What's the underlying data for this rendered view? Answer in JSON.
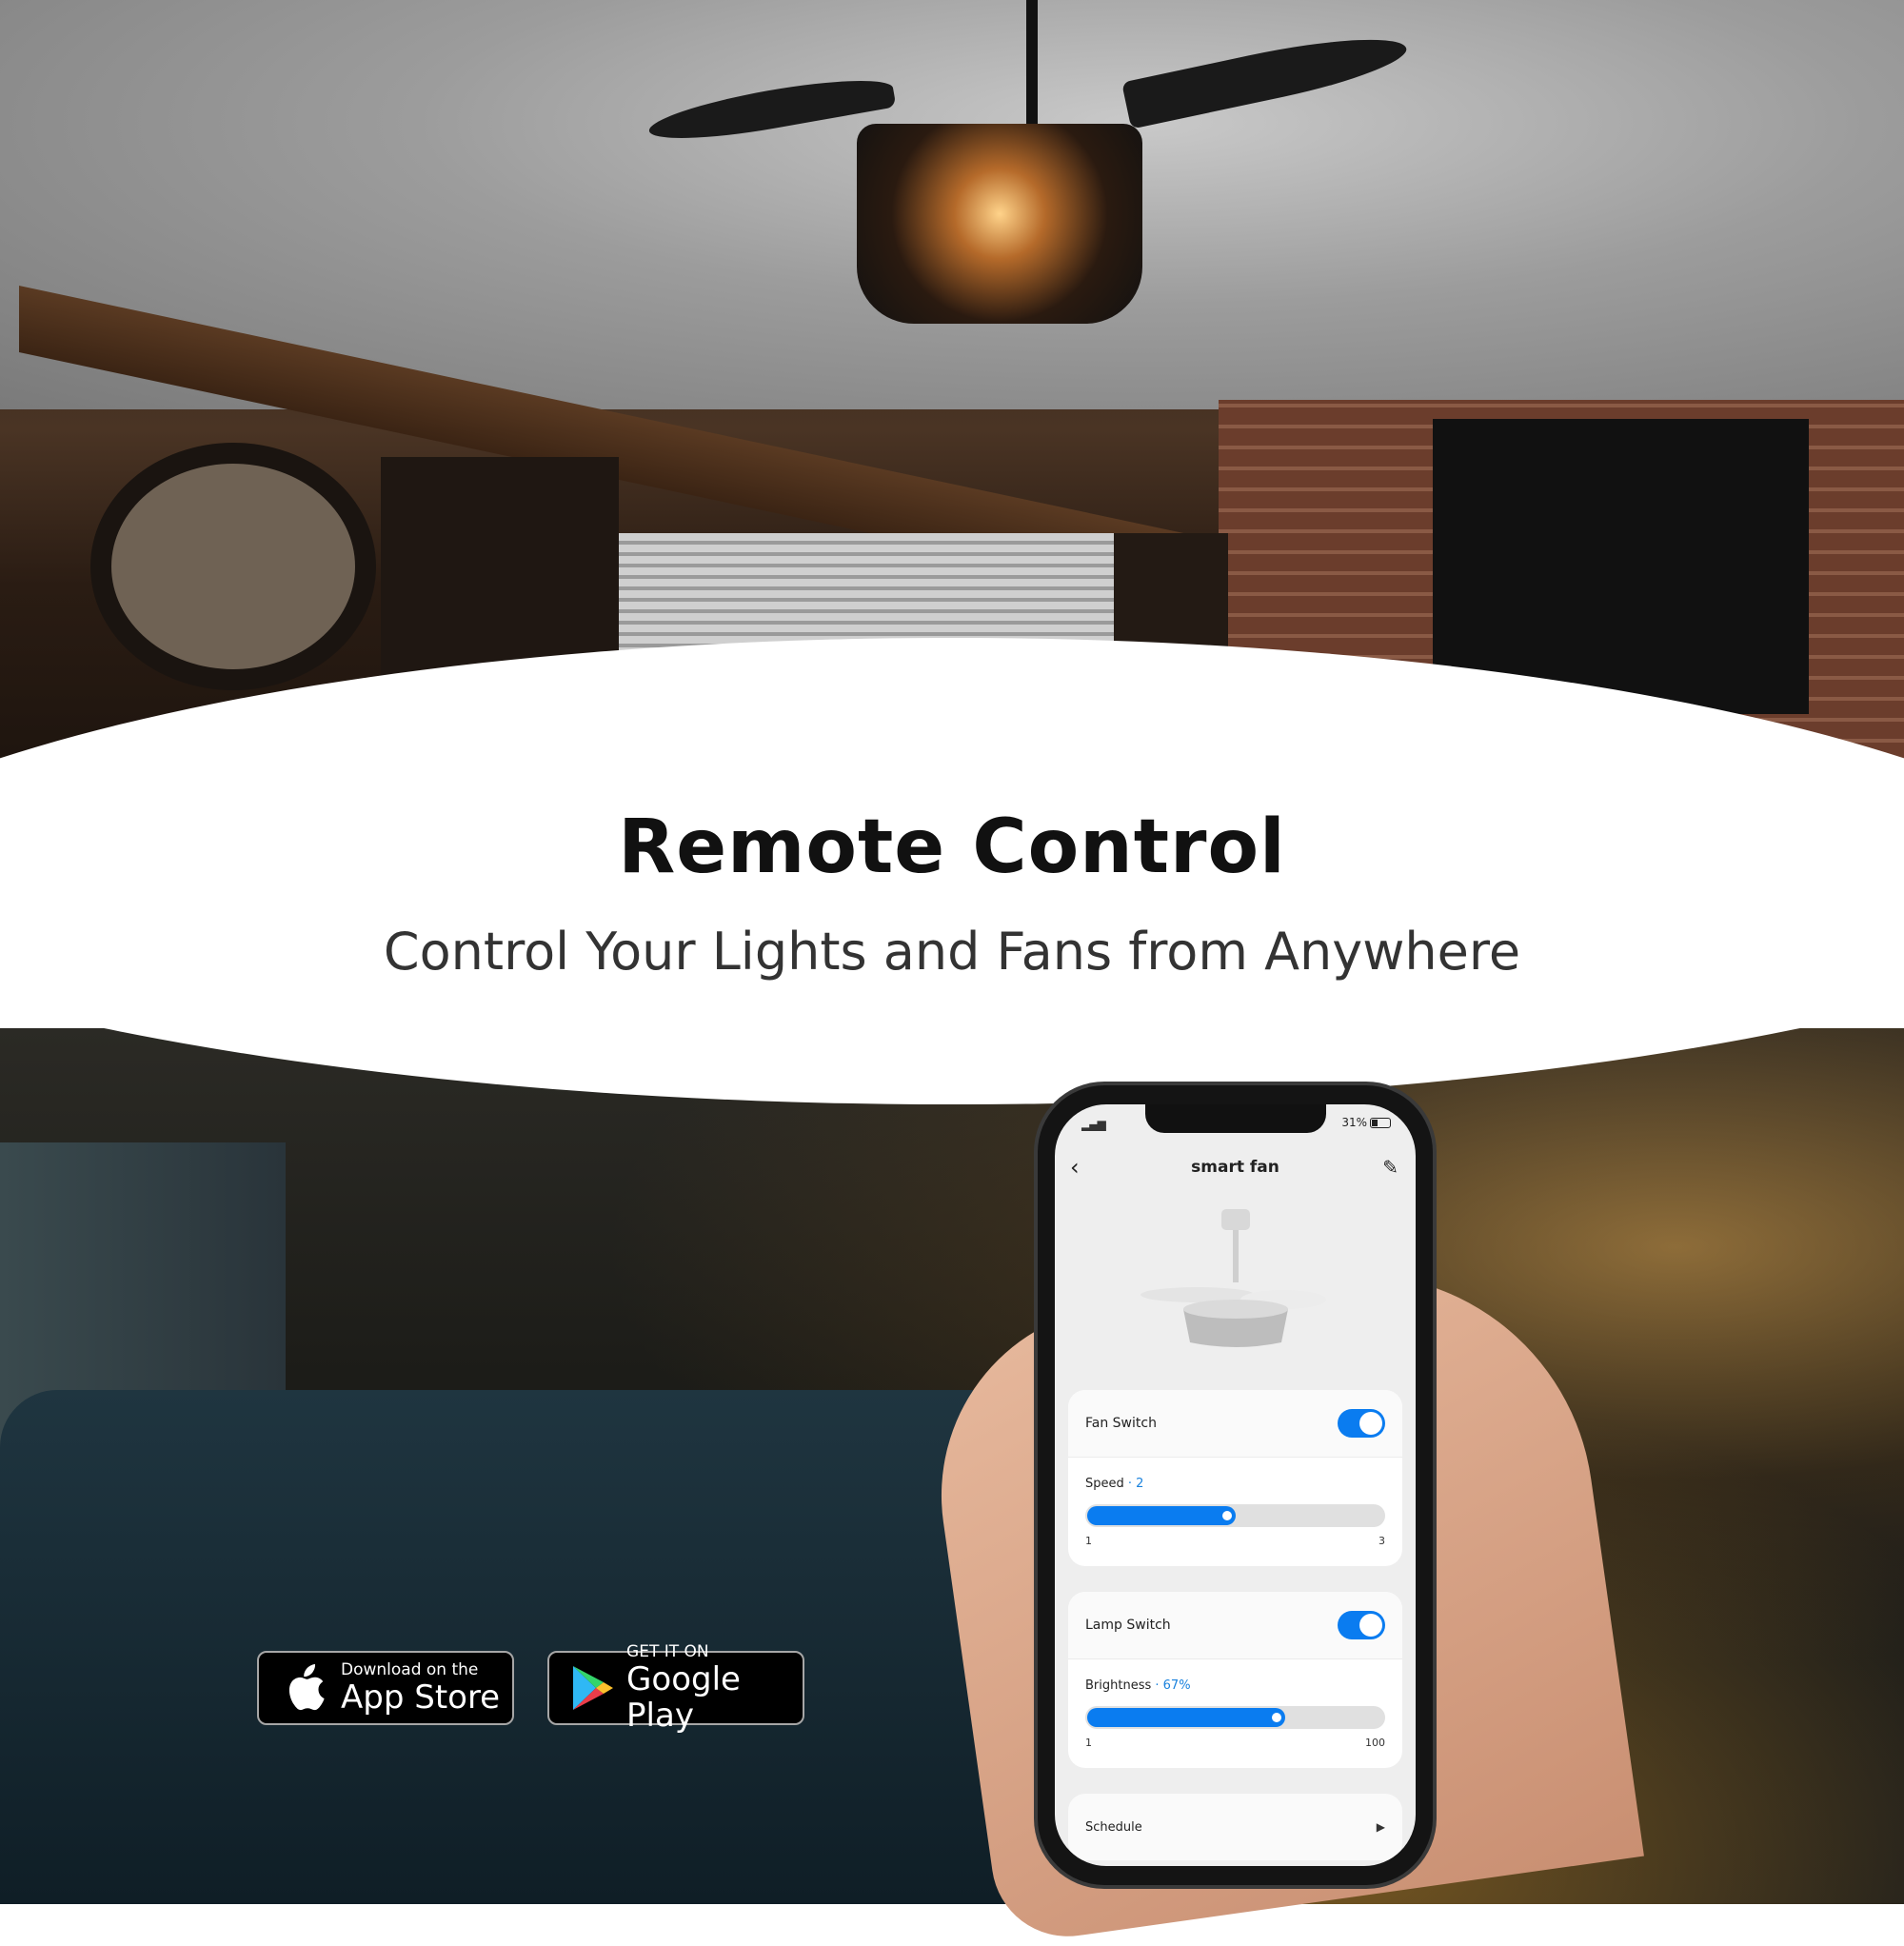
{
  "heading": "Remote Control",
  "subheading": "Control Your Lights and Fans from Anywhere",
  "badges": {
    "app_store": {
      "small": "Download on the",
      "big": "App Store",
      "icon": "apple-icon"
    },
    "google_play": {
      "small": "GET IT ON",
      "big": "Google Play",
      "icon": "google-play-icon"
    }
  },
  "phone": {
    "status": {
      "signal_icon": "signal-icon",
      "battery": "31%",
      "battery_icon": "battery-icon"
    },
    "nav": {
      "back_icon": "chevron-left-icon",
      "title": "smart fan",
      "edit_icon": "pencil-icon"
    },
    "fan_card": {
      "switch_label": "Fan Switch",
      "switch_on": true,
      "slider_label": "Speed",
      "slider_value_text": "· 2",
      "slider_value": 2,
      "min": "1",
      "max": "3",
      "fill_fraction": 0.5
    },
    "lamp_card": {
      "switch_label": "Lamp Switch",
      "switch_on": true,
      "slider_label": "Brightness",
      "slider_value_text": "· 67%",
      "slider_value": 67,
      "min": "1",
      "max": "100",
      "fill_fraction": 0.67
    },
    "schedule": {
      "label": "Schedule",
      "icon": "caret-right-icon"
    }
  },
  "colors": {
    "accent": "#0a7cf0",
    "value_text": "#1a82dd"
  }
}
